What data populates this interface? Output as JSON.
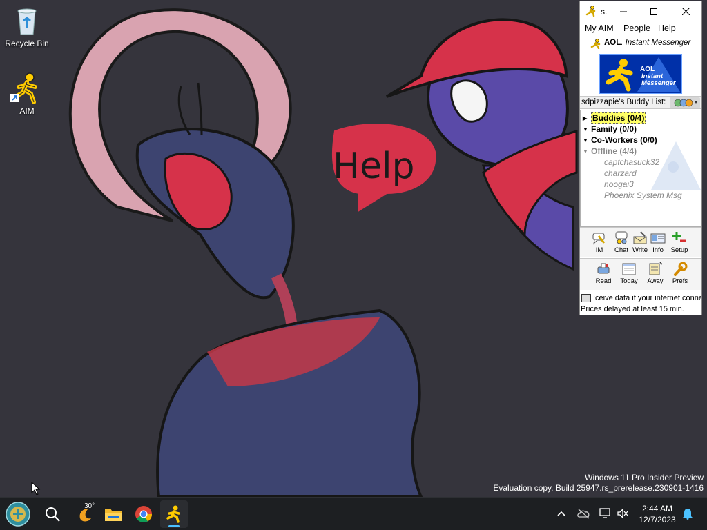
{
  "desktop": {
    "icons": [
      {
        "label": "Recycle Bin",
        "icon": "recycle-bin-icon"
      },
      {
        "label": "AIM",
        "icon": "aim-running-man-icon"
      }
    ],
    "wallpaper_speech_text": "Help",
    "watermark": {
      "line1": "Windows 11 Pro Insider Preview",
      "line2": "Evaluation copy. Build 25947.rs_prerelease.230901-1416"
    }
  },
  "aim_window": {
    "title": "s.",
    "menu": [
      "My AIM",
      "People",
      "Help"
    ],
    "brand_aol": "AOL",
    "brand_product": "Instant Messenger",
    "banner_line1": "AOL",
    "banner_line2": "Instant Messenger",
    "buddy_list_header": "sdpizzapie's Buddy List:",
    "groups": [
      {
        "label": "Buddies (0/4)"
      },
      {
        "label": "Family (0/0)"
      },
      {
        "label": "Co-Workers (0/0)"
      },
      {
        "label": "Offline (4/4)"
      }
    ],
    "offline_buddies": [
      "captchasuck32",
      "charzard",
      "noogai3",
      "Phoenix System Msg"
    ],
    "toolbar1": [
      "IM",
      "Chat",
      "Write",
      "Info",
      "Setup"
    ],
    "toolbar2": [
      "Read",
      "Today",
      "Away",
      "Prefs"
    ],
    "ticker_line1": ":ceive data if your internet conne",
    "ticker_line2": "Prices delayed at least 15 min."
  },
  "taskbar": {
    "weather_temp": "30°",
    "clock_time": "2:44 AM",
    "clock_date": "12/7/2023",
    "accent_color": "#4cc2ff"
  },
  "colors": {
    "wallpaper": "#35343c",
    "aim_yellow": "#ffcc00",
    "aim_blue": "#0030a8"
  }
}
